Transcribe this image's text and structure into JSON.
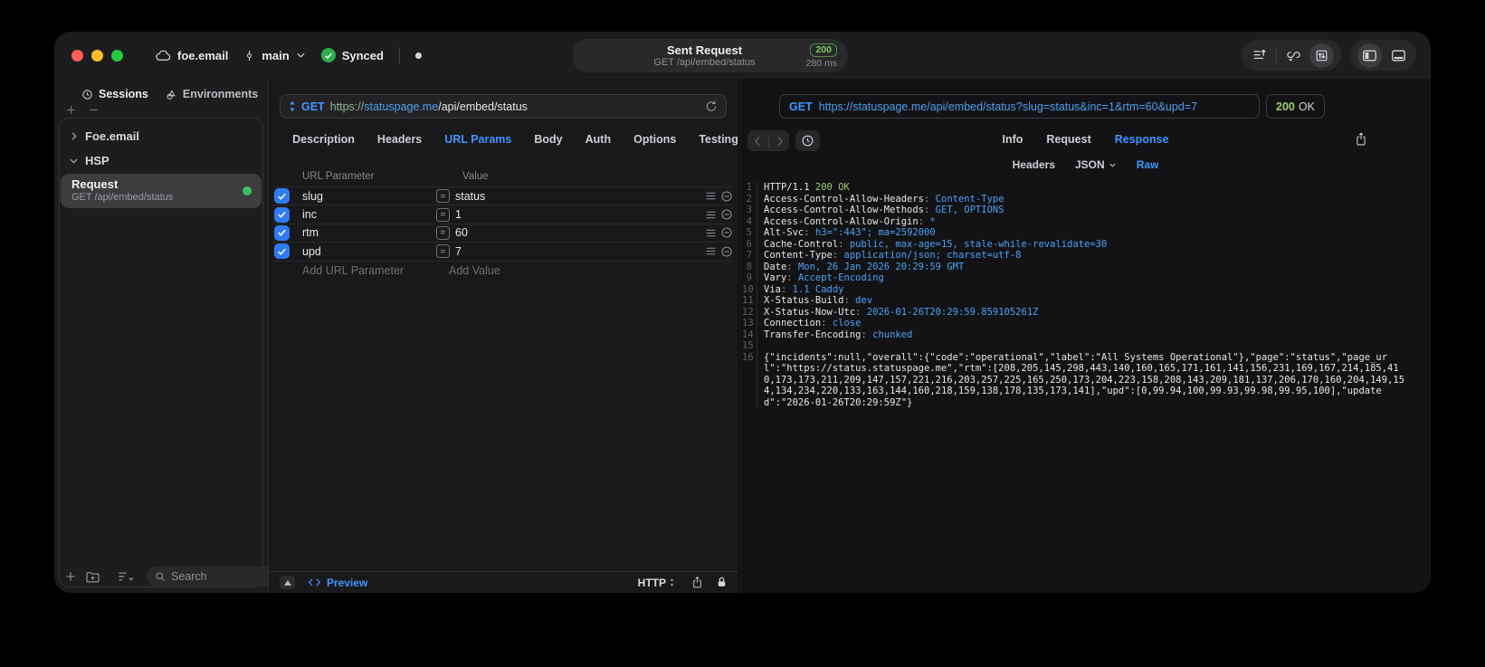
{
  "colors": {
    "accent_blue": "#3f96ff",
    "code_blue": "#4da2f8",
    "code_green": "#9dcc74",
    "status_green": "#7cc95c",
    "dot_green": "#3bbf5c",
    "checkbox_blue": "#2e7cf6"
  },
  "titlebar": {
    "project": "foe.email",
    "branch": "main",
    "sync_label": "Synced",
    "tab_title": "Sent Request",
    "tab_subtitle": "GET /api/embed/status",
    "tab_status": "200",
    "tab_duration": "280 ms"
  },
  "sidebar": {
    "tabs": [
      {
        "label": "Sessions",
        "icon": "clock-icon",
        "active": true
      },
      {
        "label": "Environments",
        "icon": "shapes-icon",
        "active": false
      }
    ],
    "groups": [
      {
        "label": "Foe.email",
        "expanded": false
      },
      {
        "label": "HSP",
        "expanded": true
      }
    ],
    "request": {
      "title": "Request",
      "subtitle": "GET /api/embed/status"
    },
    "search_placeholder": "Search"
  },
  "request_panel": {
    "method": "GET",
    "url": {
      "scheme": "https://",
      "host": "statuspage.me",
      "path": "/api/embed/status"
    },
    "tabs": [
      "Description",
      "Headers",
      "URL Params",
      "Body",
      "Auth",
      "Options",
      "Testing"
    ],
    "active_tab": "URL Params",
    "params": {
      "columns": [
        "URL Parameter",
        "Value"
      ],
      "rows": [
        {
          "name": "slug",
          "value": "status",
          "checked": true
        },
        {
          "name": "inc",
          "value": "1",
          "checked": true
        },
        {
          "name": "rtm",
          "value": "60",
          "checked": true
        },
        {
          "name": "upd",
          "value": "7",
          "checked": true
        }
      ],
      "add_name_placeholder": "Add URL Parameter",
      "add_value_placeholder": "Add Value"
    },
    "footer": {
      "preview_label": "Preview",
      "protocol": "HTTP"
    }
  },
  "response_panel": {
    "method": "GET",
    "url": "https://statuspage.me/api/embed/status?slug=status&inc=1&rtm=60&upd=7",
    "status": "200",
    "status_text": "OK",
    "tabs": [
      {
        "label": "Info",
        "active": false
      },
      {
        "label": "Request",
        "active": false
      },
      {
        "label": "Response",
        "active": true
      }
    ],
    "subtabs": [
      {
        "label": "Headers",
        "active": false
      },
      {
        "label": "JSON",
        "active": false,
        "dropdown": true
      },
      {
        "label": "Raw",
        "active": true
      }
    ],
    "body_lines": [
      {
        "num": 1,
        "segments": [
          {
            "t": "HTTP/1.1 ",
            "c": "w"
          },
          {
            "t": "200 OK",
            "c": "g"
          }
        ]
      },
      {
        "num": 2,
        "segments": [
          {
            "t": "Access-Control-Allow-Headers",
            "c": "w"
          },
          {
            "t": ": ",
            "c": "p"
          },
          {
            "t": "Content-Type",
            "c": "v"
          }
        ]
      },
      {
        "num": 3,
        "segments": [
          {
            "t": "Access-Control-Allow-Methods",
            "c": "w"
          },
          {
            "t": ": ",
            "c": "p"
          },
          {
            "t": "GET, OPTIONS",
            "c": "v"
          }
        ]
      },
      {
        "num": 4,
        "segments": [
          {
            "t": "Access-Control-Allow-Origin",
            "c": "w"
          },
          {
            "t": ": ",
            "c": "p"
          },
          {
            "t": "*",
            "c": "v"
          }
        ]
      },
      {
        "num": 5,
        "segments": [
          {
            "t": "Alt-Svc",
            "c": "w"
          },
          {
            "t": ": ",
            "c": "p"
          },
          {
            "t": "h3=\":443\"; ma=2592000",
            "c": "v"
          }
        ]
      },
      {
        "num": 6,
        "segments": [
          {
            "t": "Cache-Control",
            "c": "w"
          },
          {
            "t": ": ",
            "c": "p"
          },
          {
            "t": "public, max-age=15, stale-while-revalidate=30",
            "c": "v"
          }
        ]
      },
      {
        "num": 7,
        "segments": [
          {
            "t": "Content-Type",
            "c": "w"
          },
          {
            "t": ": ",
            "c": "p"
          },
          {
            "t": "application/json; charset=utf-8",
            "c": "v"
          }
        ]
      },
      {
        "num": 8,
        "segments": [
          {
            "t": "Date",
            "c": "w"
          },
          {
            "t": ": ",
            "c": "p"
          },
          {
            "t": "Mon, 26 Jan 2026 20:29:59 GMT",
            "c": "v"
          }
        ]
      },
      {
        "num": 9,
        "segments": [
          {
            "t": "Vary",
            "c": "w"
          },
          {
            "t": ": ",
            "c": "p"
          },
          {
            "t": "Accept-Encoding",
            "c": "v"
          }
        ]
      },
      {
        "num": 10,
        "segments": [
          {
            "t": "Via",
            "c": "w"
          },
          {
            "t": ": ",
            "c": "p"
          },
          {
            "t": "1.1 Caddy",
            "c": "v"
          }
        ]
      },
      {
        "num": 11,
        "segments": [
          {
            "t": "X-Status-Build",
            "c": "w"
          },
          {
            "t": ": ",
            "c": "p"
          },
          {
            "t": "dev",
            "c": "v"
          }
        ]
      },
      {
        "num": 12,
        "segments": [
          {
            "t": "X-Status-Now-Utc",
            "c": "w"
          },
          {
            "t": ": ",
            "c": "p"
          },
          {
            "t": "2026-01-26T20:29:59.859105261Z",
            "c": "v"
          }
        ]
      },
      {
        "num": 13,
        "segments": [
          {
            "t": "Connection",
            "c": "w"
          },
          {
            "t": ": ",
            "c": "p"
          },
          {
            "t": "close",
            "c": "v"
          }
        ]
      },
      {
        "num": 14,
        "segments": [
          {
            "t": "Transfer-Encoding",
            "c": "w"
          },
          {
            "t": ": ",
            "c": "p"
          },
          {
            "t": "chunked",
            "c": "v"
          }
        ]
      },
      {
        "num": 15,
        "segments": []
      },
      {
        "num": 16,
        "segments": [
          {
            "t": "{\"incidents\":null,\"overall\":{\"code\":\"operational\",\"label\":\"All Systems Operational\"},\"page\":\"status\",\"page_url\":\"https://status.statuspage.me\",\"rtm\":[208,205,145,298,443,140,160,165,171,161,141,156,231,169,167,214,185,410,173,173,211,209,147,157,221,216,203,257,225,165,250,173,204,223,158,208,143,209,181,137,206,170,160,204,149,154,134,234,220,133,163,144,160,218,159,138,178,135,173,141],\"upd\":[0,99.94,100,99.93,99.98,99.95,100],\"updated\":\"2026-01-26T20:29:59Z\"}",
            "c": "w"
          }
        ]
      }
    ]
  }
}
